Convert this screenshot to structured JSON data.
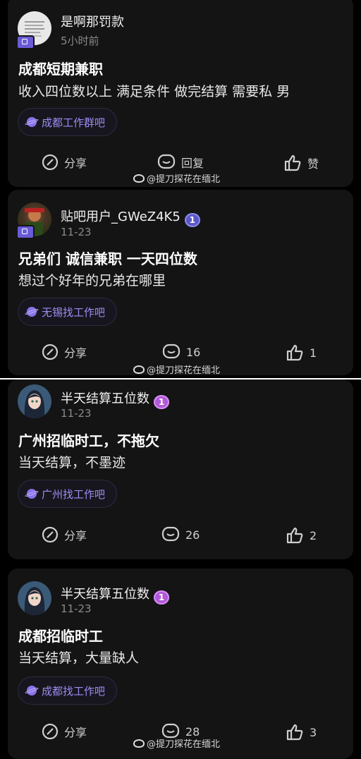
{
  "posts": [
    {
      "username": "是啊那罚款",
      "time": "5小时前",
      "title": "成都短期兼职",
      "body": "收入四位数以上 满足条件 做完结算 需要私 男",
      "tag": "成都工作群吧",
      "share_label": "分享",
      "comment_label": "回复",
      "like_label": "赞",
      "watermark": "@提刀探花在缅北"
    },
    {
      "username": "贴吧用户_GWeZ4K5",
      "level": "1",
      "time": "11-23",
      "title": "兄弟们 诚信兼职 一天四位数",
      "body": "想过个好年的兄弟在哪里",
      "tag": "无锡找工作吧",
      "share_label": "分享",
      "comment_label": "16",
      "like_label": "1",
      "watermark": "@提刀探花在缅北"
    },
    {
      "username": "半天结算五位数",
      "level": "1",
      "time": "11-23",
      "title": "广州招临时工，不拖欠",
      "body": "当天结算，不墨迹",
      "tag": "广州找工作吧",
      "share_label": "分享",
      "comment_label": "26",
      "like_label": "2"
    },
    {
      "username": "半天结算五位数",
      "level": "1",
      "time": "11-23",
      "title": "成都招临时工",
      "body": "当天结算，大量缺人",
      "tag": "成都找工作吧",
      "share_label": "分享",
      "comment_label": "28",
      "like_label": "3",
      "watermark": "@提刀探花在缅北"
    }
  ],
  "colors": {
    "card": "#141414",
    "tag_text": "#9d8df2",
    "level_badge": "#5a58c8"
  }
}
